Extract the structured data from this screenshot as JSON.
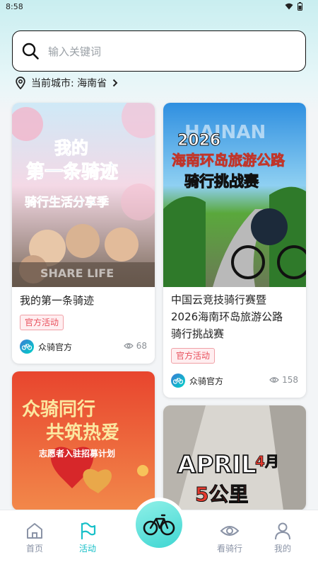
{
  "status": {
    "time": "8:58"
  },
  "search": {
    "placeholder": "输入关键词"
  },
  "city": {
    "label": "当前城市: 海南省"
  },
  "cards": [
    {
      "title": "我的第一条骑迹",
      "poster_text": [
        "我的",
        "第一条骑迹",
        "骑行生活分享季",
        "SHARE LIFE"
      ],
      "tag": "官方活动",
      "author": "众骑官方",
      "views": "68"
    },
    {
      "title": "中国云竞技骑行赛暨2026海南环岛旅游公路骑行挑战赛",
      "title_lines": [
        "中国云竞技骑行赛暨",
        "2026海南环岛旅游公路",
        "骑行挑战赛"
      ],
      "poster_text": [
        "HAINAN",
        "2026",
        "海南环岛旅游公路",
        "骑行挑战赛"
      ],
      "tag": "官方活动",
      "author": "众骑官方",
      "views": "158"
    },
    {
      "poster_text": [
        "众骑同行",
        "共筑热爱",
        "志愿者入驻招募计划"
      ]
    },
    {
      "poster_text": [
        "APRIL",
        "4月",
        "5公里"
      ]
    }
  ],
  "nav": {
    "items": [
      {
        "label": "首页",
        "icon": "home-icon"
      },
      {
        "label": "活动",
        "icon": "flag-icon"
      },
      {
        "label": "看骑行",
        "icon": "eye-icon"
      },
      {
        "label": "我的",
        "icon": "user-icon"
      }
    ],
    "center_icon": "bicycle-icon",
    "active_color": "#18c0c8",
    "inactive_color": "#8a93a6"
  },
  "colors": {
    "tag_text": "#e8505c",
    "tag_bg": "#ffeef0",
    "accent": "#18c0c8"
  }
}
